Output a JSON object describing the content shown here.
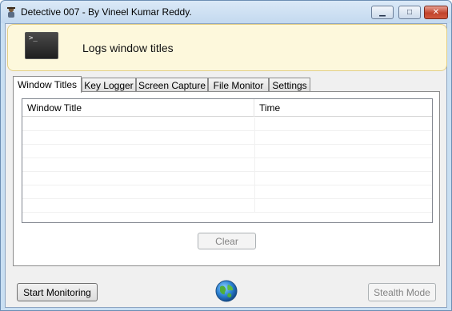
{
  "window": {
    "title": "Detective 007 - By Vineel Kumar Reddy.",
    "minimize_glyph": "▁",
    "maximize_glyph": "□",
    "close_glyph": "✕"
  },
  "banner": {
    "icon": "terminal-icon",
    "icon_glyph": ">_",
    "text": "Logs window titles"
  },
  "tabs": [
    {
      "label": "Window Titles",
      "active": true
    },
    {
      "label": "Key Logger",
      "active": false
    },
    {
      "label": "Screen Capture",
      "active": false
    },
    {
      "label": "File Monitor",
      "active": false
    },
    {
      "label": "Settings",
      "active": false
    }
  ],
  "list": {
    "columns": [
      "Window Title",
      "Time"
    ],
    "rows": []
  },
  "buttons": {
    "clear": "Clear",
    "start_monitoring": "Start Monitoring",
    "stealth_mode": "Stealth Mode"
  },
  "status_icon": "globe-icon",
  "colors": {
    "banner_bg": "#fdf8dc",
    "banner_border": "#e3cf86",
    "close_button": "#c2432b"
  }
}
